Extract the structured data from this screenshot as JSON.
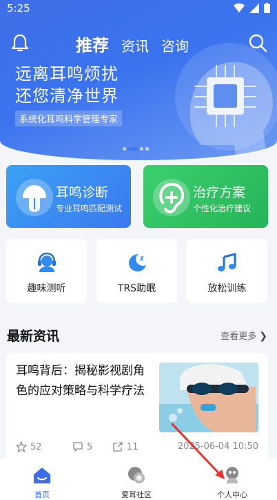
{
  "status_bar": {
    "time": "5:25"
  },
  "top_nav": {
    "tabs": [
      {
        "label": "推荐",
        "active": true
      },
      {
        "label": "资讯",
        "active": false
      },
      {
        "label": "咨询",
        "active": false
      }
    ]
  },
  "banner": {
    "line1": "远离耳鸣烦扰",
    "line2": "还您清净世界",
    "subtitle": "系统化耳鸣科学管理专家",
    "slide_count": 4,
    "active_slide": 2
  },
  "feature_cards": [
    {
      "title": "耳鸣诊断",
      "subtitle": "专业耳鸣匹配测试",
      "color": "#3b8cf2"
    },
    {
      "title": "治疗方案",
      "subtitle": "个性化治疗建议",
      "color": "#30c263"
    }
  ],
  "shortcuts": [
    {
      "label": "趣味测听",
      "icon": "headset-icon"
    },
    {
      "label": "TRS助眠",
      "icon": "moon-icon"
    },
    {
      "label": "放松训练",
      "icon": "music-note-icon"
    }
  ],
  "news_section": {
    "title": "最新资讯",
    "more_label": "查看更多"
  },
  "news_item": {
    "title": "耳鸣背后：揭秘影视剧角色的应对策略与科学疗法",
    "likes": "52",
    "comments": "5",
    "shares": "11",
    "date": "2025-06-04 10:50"
  },
  "tab_bar": [
    {
      "label": "首页",
      "active": true
    },
    {
      "label": "爱耳社区",
      "active": false
    },
    {
      "label": "个人中心",
      "active": false
    }
  ],
  "colors": {
    "primary": "#3d6ee8",
    "accent_green": "#30c263",
    "annotation": "#e8322f"
  }
}
